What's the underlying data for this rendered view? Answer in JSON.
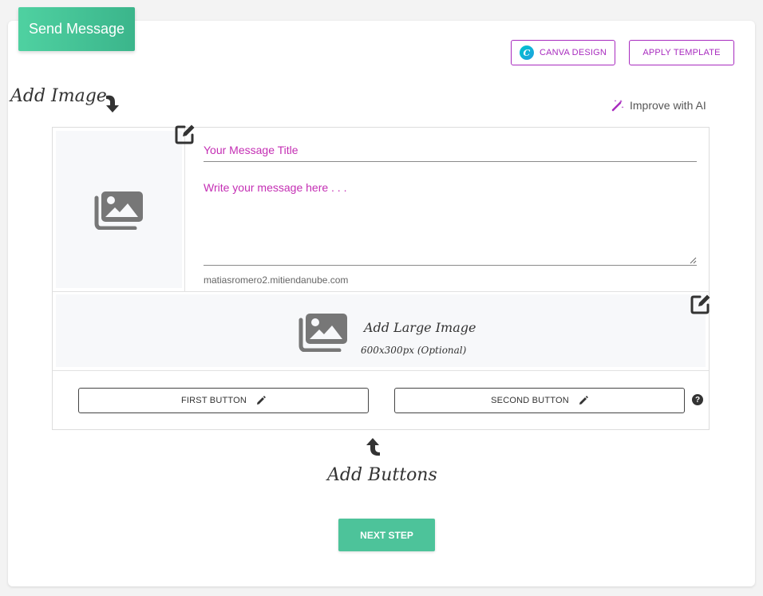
{
  "header": {
    "title": "Send Message"
  },
  "toolbar": {
    "canva_label": "CANVA DESIGN",
    "canva_logo_letter": "C",
    "template_label": "APPLY TEMPLATE"
  },
  "annotations": {
    "add_image": "Add Image",
    "add_buttons": "Add Buttons"
  },
  "improve_ai": {
    "label": "Improve with AI"
  },
  "composer": {
    "title_placeholder": "Your Message Title",
    "message_placeholder": "Write your message here . . .",
    "domain": "matiasromero2.mitiendanube.com",
    "large_image_title": "Add Large Image",
    "large_image_sub": "600x300px (Optional)",
    "first_button": "FIRST BUTTON",
    "second_button": "SECOND BUTTON",
    "help": "?"
  },
  "footer": {
    "next_label": "NEXT STEP"
  },
  "colors": {
    "accent": "#4dc39a",
    "purple": "#a82bbf",
    "magenta_text": "#c42fb4",
    "icon_gray": "#777777"
  },
  "icons": {
    "image": "images-icon",
    "edit": "edit-square-icon",
    "pencil": "pencil-icon",
    "magic": "magic-wand-icon",
    "help": "question-circle-icon",
    "arrow_down": "curved-arrow-down-icon",
    "arrow_up": "curved-arrow-up-icon"
  }
}
